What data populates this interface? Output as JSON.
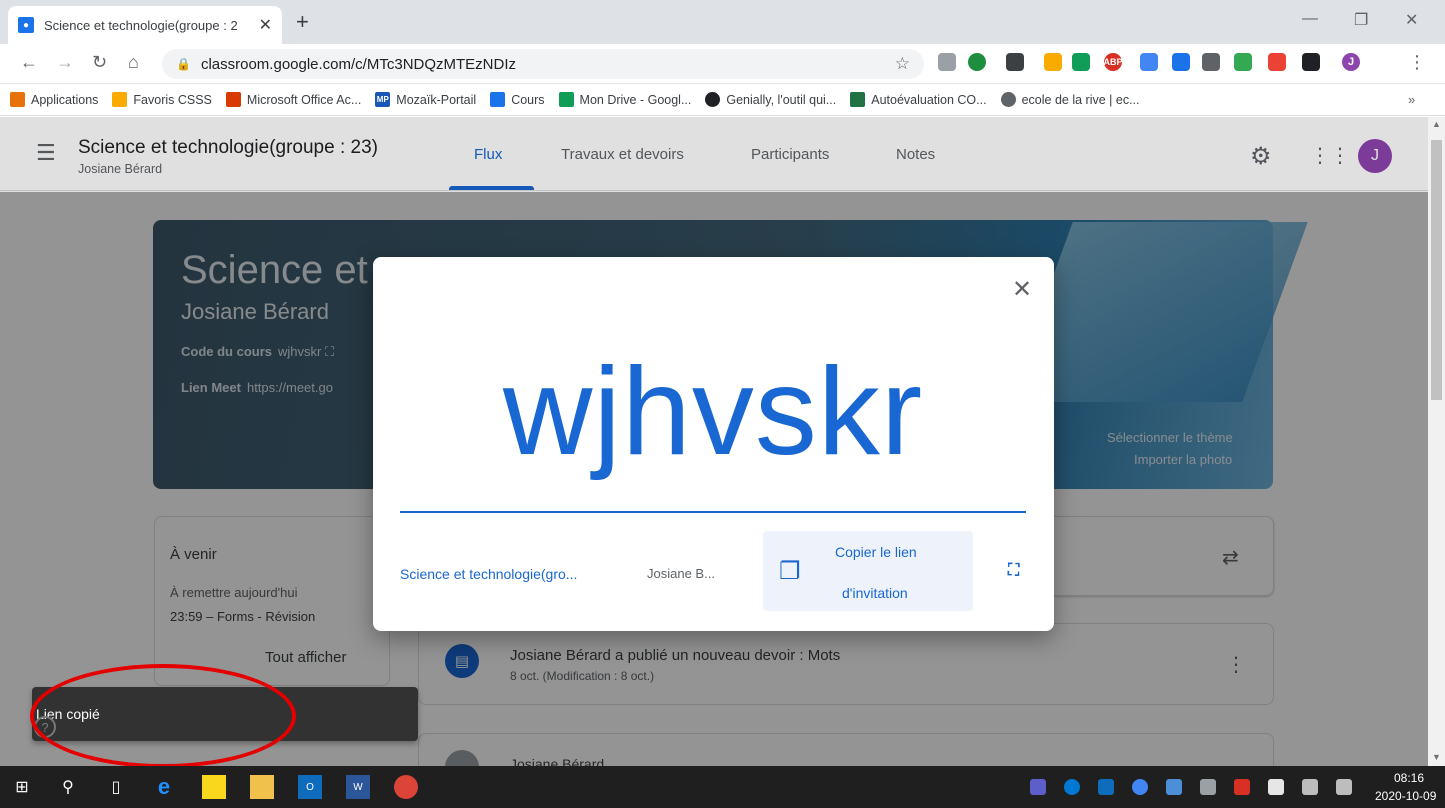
{
  "browser": {
    "tab_title": "Science et technologie(groupe : 2",
    "url": "classroom.google.com/c/MTc3NDQzMTEzNDIz"
  },
  "bookmarks": [
    {
      "label": "Applications",
      "color": "#e8710a"
    },
    {
      "label": "Favoris CSSS",
      "color": "#f9ab00"
    },
    {
      "label": "Microsoft Office Ac...",
      "color": "#d83b01"
    },
    {
      "label": "Mozaïk-Portail",
      "color": "#1a56b8"
    },
    {
      "label": "Cours",
      "color": "#1a73e8"
    },
    {
      "label": "Mon Drive - Googl...",
      "color": "#0f9d58"
    },
    {
      "label": "Genially, l'outil qui...",
      "color": "#202124"
    },
    {
      "label": "Autoévaluation CO...",
      "color": "#217346"
    },
    {
      "label": "ecole de la rive | ec...",
      "color": "#5f6368"
    }
  ],
  "header": {
    "class_title": "Science et technologie(groupe : 23)",
    "owner": "Josiane Bérard",
    "tabs": [
      "Flux",
      "Travaux et devoirs",
      "Participants",
      "Notes"
    ],
    "avatar_letter": "J"
  },
  "banner": {
    "title": "Science et",
    "owner": "Josiane Bérard",
    "code_label": "Code du cours",
    "code_value": "wjhvskr",
    "meet_label": "Lien Meet",
    "meet_value": "https://meet.go",
    "theme_button": "Sélectionner le thème",
    "photo_button": "Importer la photo"
  },
  "upcoming": {
    "title": "À venir",
    "due": "À remettre aujourd'hui",
    "item": "23:59 – Forms - Révision",
    "view_all": "Tout afficher"
  },
  "stream": {
    "post_title": "Josiane Bérard a publié un nouveau devoir : Mots",
    "post_date": "8 oct. (Modification : 8 oct.)",
    "next_author": "Josiane Bérard"
  },
  "dialog": {
    "code": "wjhvskr",
    "class_name": "Science et technologie(gro...",
    "owner_short": "Josiane B...",
    "copy_line1": "Copier le lien",
    "copy_line2": "d'invitation"
  },
  "toast": {
    "message": "Lien copié"
  },
  "taskbar": {
    "time": "08:16",
    "date": "2020-10-09"
  },
  "colors": {
    "accent": "#1967d2",
    "annotation": "#e50000"
  }
}
